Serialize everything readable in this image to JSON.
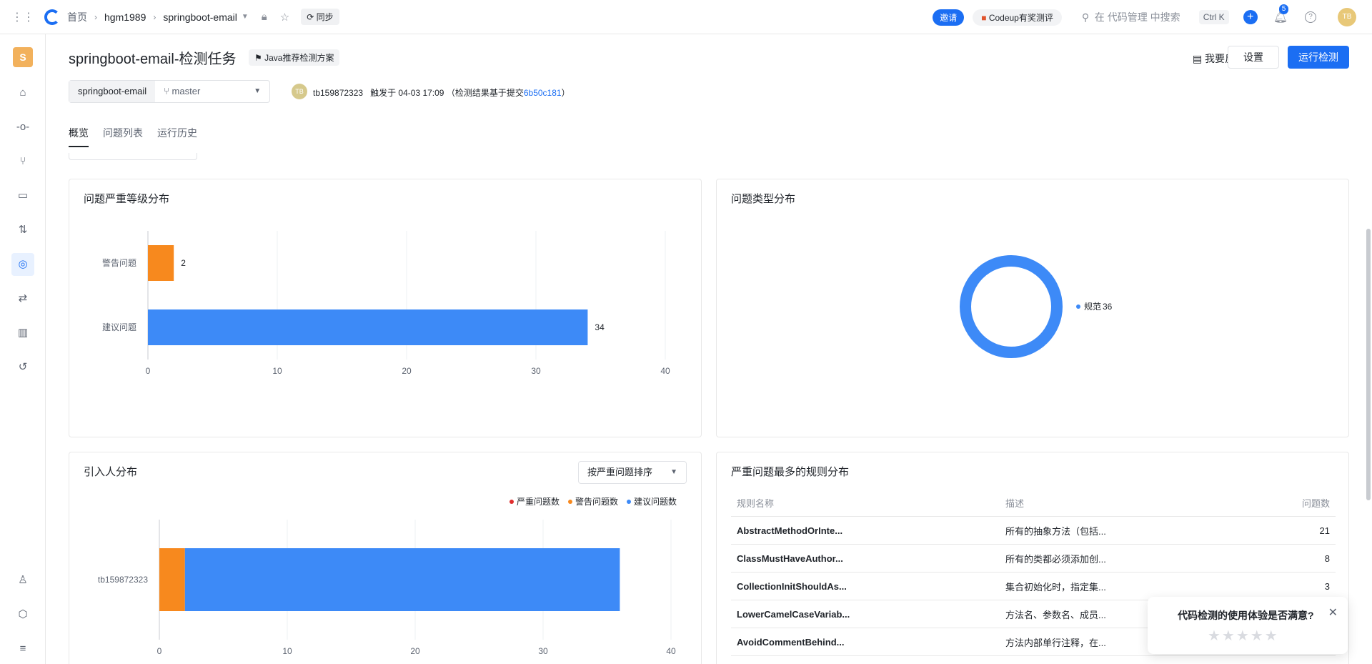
{
  "topbar": {
    "home": "首页",
    "org": "hgm1989",
    "repo": "springboot-email",
    "sync": "同步",
    "invite": "邀请",
    "codeup": "Codeup有奖测评",
    "search_placeholder": "在 代码管理 中搜索",
    "shortcut": "Ctrl K",
    "notifications": "5",
    "user_initials": "TB"
  },
  "sidebar": {
    "project_initial": "S",
    "icons": [
      "home-icon",
      "commit-icon",
      "branch-icon",
      "tag-icon",
      "merge-request-icon",
      "code-scan-icon",
      "pipeline-icon",
      "chart-icon",
      "history-icon",
      "member-icon",
      "settings-icon",
      "collapse-icon"
    ]
  },
  "header": {
    "title": "springboot-email-检测任务",
    "scheme": "Java推荐检测方案",
    "feedback": "我要反馈",
    "settings": "设置",
    "run": "运行检测"
  },
  "context": {
    "repo": "springboot-email",
    "branch": "master",
    "author_initials": "TB",
    "author": "tb159872323",
    "trigger": "触发于 04-03 17:09",
    "basis_prefix": "（检测结果基于提交",
    "commit": "6b50c181",
    "basis_suffix": "）"
  },
  "tabs": [
    "概览",
    "问题列表",
    "运行历史"
  ],
  "severity_card": {
    "title": "问题严重等级分布"
  },
  "type_card": {
    "title": "问题类型分布"
  },
  "introducer_card": {
    "title": "引入人分布",
    "sort_label": "按严重问题排序",
    "legend": [
      "严重问题数",
      "警告问题数",
      "建议问题数"
    ]
  },
  "rules_card": {
    "title": "严重问题最多的规则分布",
    "headers": [
      "规则名称",
      "描述",
      "问题数"
    ],
    "rows": [
      {
        "name": "AbstractMethodOrInte...",
        "desc": "所有的抽象方法（包括...",
        "count": "21"
      },
      {
        "name": "ClassMustHaveAuthor...",
        "desc": "所有的类都必须添加创...",
        "count": "8"
      },
      {
        "name": "CollectionInitShouldAs...",
        "desc": "集合初始化时，指定集...",
        "count": "3"
      },
      {
        "name": "LowerCamelCaseVariab...",
        "desc": "方法名、参数名、成员...",
        "count": "2"
      },
      {
        "name": "AvoidCommentBehind...",
        "desc": "方法内部单行注释，在...",
        "count": "2"
      }
    ]
  },
  "popup": {
    "question": "代码检测的使用体验是否满意?"
  },
  "colors": {
    "primary": "#1b6ef3",
    "warning": "#f7891e",
    "suggest": "#3d8af7",
    "severe": "#e02d2d"
  },
  "chart_data": [
    {
      "type": "bar",
      "orientation": "horizontal",
      "title": "问题严重等级分布",
      "categories": [
        "警告问题",
        "建议问题"
      ],
      "values": [
        2,
        34
      ],
      "colors": [
        "#f7891e",
        "#3d8af7"
      ],
      "xlim": [
        0,
        40
      ],
      "xticks": [
        0,
        10,
        20,
        30,
        40
      ],
      "grid": true
    },
    {
      "type": "pie",
      "style": "donut",
      "title": "问题类型分布",
      "slices": [
        {
          "label": "规范",
          "value": 36,
          "color": "#3d8af7"
        }
      ],
      "legend_position": "right"
    },
    {
      "type": "bar",
      "orientation": "horizontal",
      "stacked": true,
      "title": "引入人分布",
      "categories": [
        "tb159872323"
      ],
      "series": [
        {
          "name": "严重问题数",
          "values": [
            0
          ],
          "color": "#e02d2d"
        },
        {
          "name": "警告问题数",
          "values": [
            2
          ],
          "color": "#f7891e"
        },
        {
          "name": "建议问题数",
          "values": [
            34
          ],
          "color": "#3d8af7"
        }
      ],
      "xlim": [
        0,
        40
      ],
      "xticks": [
        0,
        10,
        20,
        30,
        40
      ],
      "legend_position": "top-right"
    }
  ]
}
